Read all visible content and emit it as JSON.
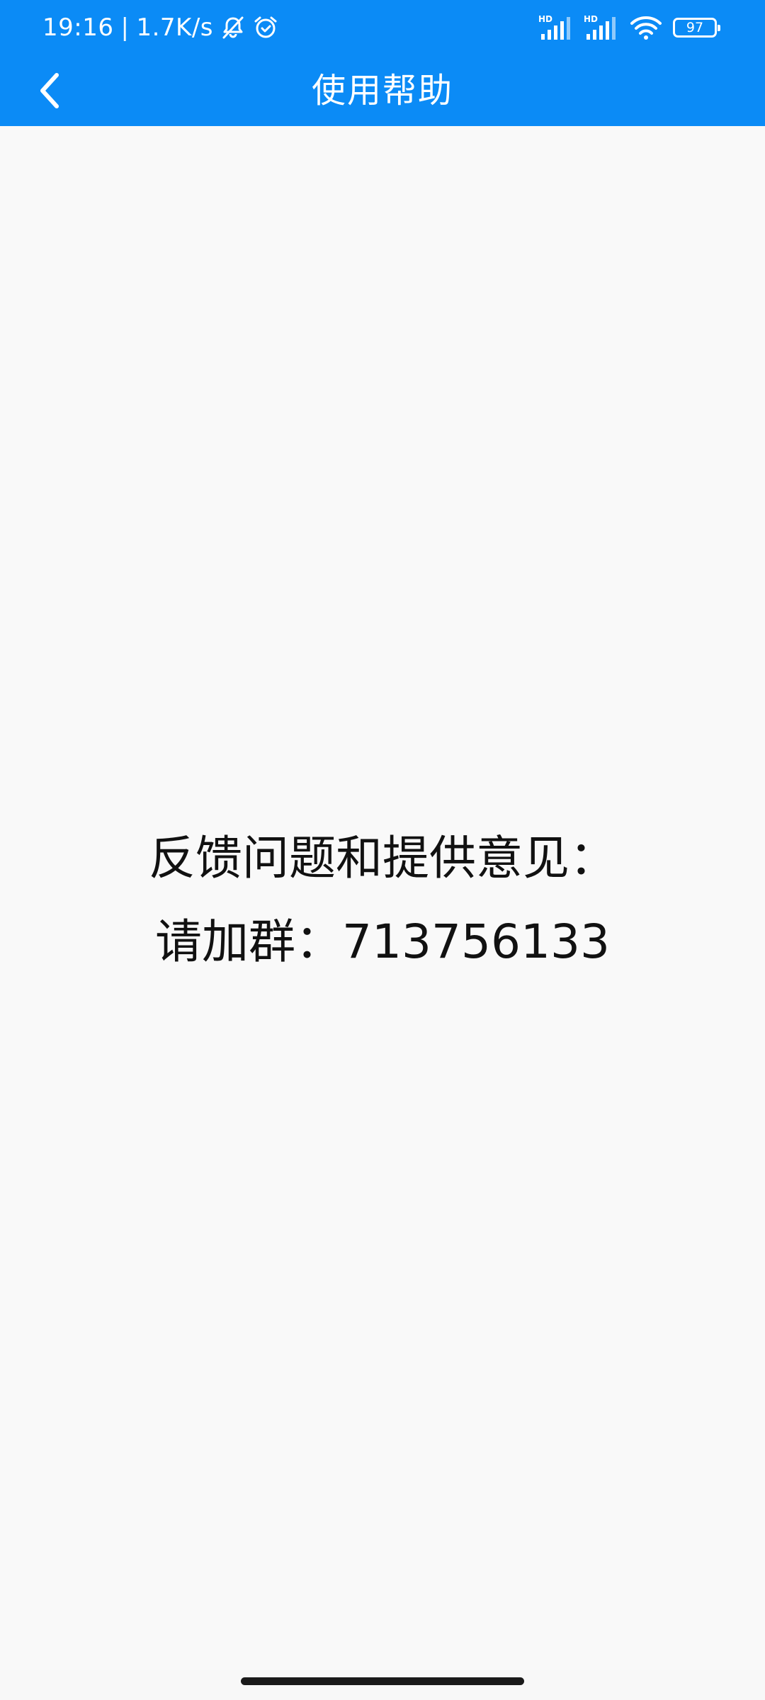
{
  "status_bar": {
    "time": "19:16",
    "separator": "|",
    "net_speed": "1.7K/s",
    "icons": [
      "bell-muted-icon",
      "alarm-icon",
      "signal-hd-icon",
      "signal-hd-icon",
      "wifi-icon",
      "battery-icon"
    ],
    "signal_1_label": "HD",
    "signal_2_label": "HD",
    "battery_level": "97"
  },
  "header": {
    "title": "使用帮助",
    "back_icon": "chevron-left-icon"
  },
  "colors": {
    "header_bg": "#0b8bf6",
    "page_bg": "#f9f9f9",
    "text": "#111111"
  },
  "main": {
    "line1": "反馈问题和提供意见：",
    "line2": "请加群：713756133"
  }
}
